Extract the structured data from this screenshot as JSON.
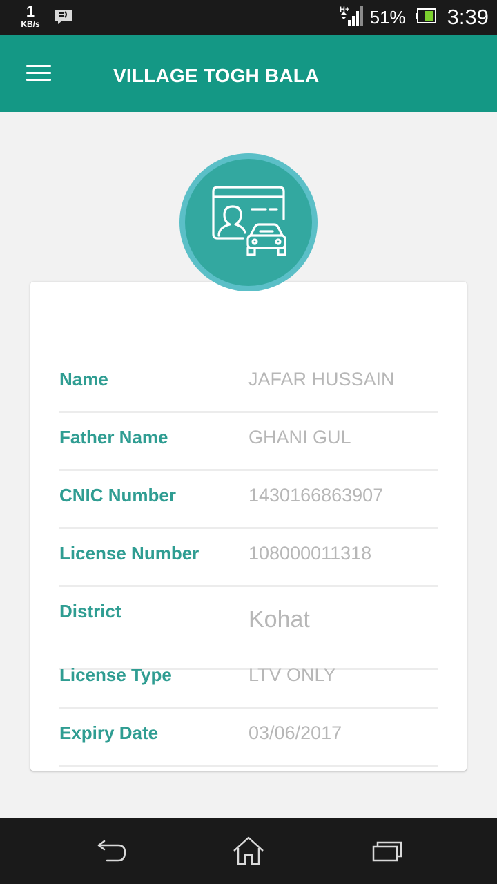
{
  "status_bar": {
    "network_speed": "1",
    "network_unit": "KB/s",
    "network_type": "H+",
    "battery_percent": "51%",
    "time": "3:39",
    "icons": [
      "notification-message-icon",
      "signal-icon",
      "battery-icon"
    ]
  },
  "app_bar": {
    "title": "VILLAGE TOGH BALA",
    "menu_icon": "hamburger-menu-icon"
  },
  "profile": {
    "icon": "license-card-car-icon"
  },
  "fields": [
    {
      "label": "Name",
      "value": "JAFAR HUSSAIN"
    },
    {
      "label": "Father Name",
      "value": "GHANI GUL"
    },
    {
      "label": "CNIC Number",
      "value": "1430166863907"
    },
    {
      "label": "License Number",
      "value": "108000011318"
    },
    {
      "label": "District",
      "value": "Kohat"
    },
    {
      "label": "License Type",
      "value": "LTV ONLY"
    },
    {
      "label": "Expiry Date",
      "value": "03/06/2017"
    }
  ],
  "nav_bar": {
    "buttons": [
      "back-icon",
      "home-icon",
      "recent-apps-icon"
    ]
  },
  "colors": {
    "app_bar": "#149885",
    "label": "#2f9d92",
    "value": "#b7b7b7",
    "avatar_ring": "#5bbfc7",
    "avatar_fill": "#33a8a0",
    "background": "#f2f2f2"
  }
}
